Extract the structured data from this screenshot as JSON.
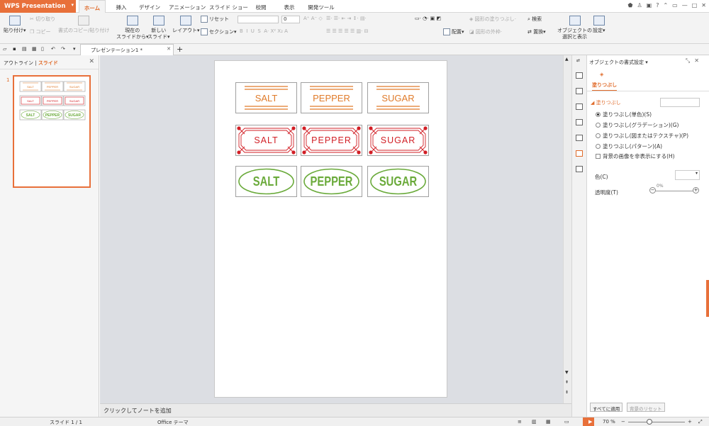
{
  "app": {
    "name": "WPS Presentation"
  },
  "tabs": [
    "ホーム",
    "挿入",
    "デザイン",
    "アニメーション",
    "スライド ショー",
    "校閲",
    "表示",
    "開発ツール"
  ],
  "ribbon": {
    "paste": "貼り付け",
    "cut": "切り取り",
    "copy": "コピー",
    "format_painter": "書式のコピー/貼り付け",
    "from_current": "現在の",
    "from_current2": "スライドから",
    "new_slide": "新しい",
    "new_slide2": "スライド",
    "layout": "レイアウト",
    "reset": "リセット",
    "section": "セクション",
    "font_size": "0",
    "shape_fill": "図形の塗りつぶし",
    "shape_outline": "図形の外枠",
    "arrange": "配置",
    "find": "検索",
    "replace": "置換",
    "select_show": "オブジェクトの",
    "select_show2": "選択と表示",
    "settings": "設定"
  },
  "document": {
    "tab_title": "プレゼンテーション1 *"
  },
  "left_pane": {
    "outline_tab": "アウトライン",
    "slide_tab": "スライド",
    "slide_number": "1"
  },
  "slide": {
    "row1": [
      "SALT",
      "PEPPER",
      "SUGAR"
    ],
    "row2": [
      "SALT",
      "PEPPER",
      "SUGAR"
    ],
    "row3": [
      "SALT",
      "PEPPER",
      "SUGAR"
    ],
    "colors": {
      "orange": "#e07b2a",
      "red": "#d21f26",
      "green": "#6aaa3a"
    }
  },
  "notes": {
    "placeholder": "クリックしてノートを追加"
  },
  "right_pane": {
    "title": "オブジェクトの書式設定",
    "tab": "塗りつぶし",
    "section": "塗りつぶし",
    "options": [
      "塗りつぶし(単色)(S)",
      "塗りつぶし(グラデーション)(G)",
      "塗りつぶし(図またはテクスチャ)(P)",
      "塗りつぶし(パターン)(A)"
    ],
    "selected_option_index": 0,
    "hide_bg": "背景の画像を非表示にする(H)",
    "color_label": "色(C)",
    "transparency_label": "透明度(T)",
    "transparency_value": "0%",
    "apply_all": "すべてに適用",
    "reset_bg": "背景のリセット"
  },
  "status": {
    "slide": "スライド 1 / 1",
    "theme": "Office テーマ",
    "zoom": "70 %"
  }
}
